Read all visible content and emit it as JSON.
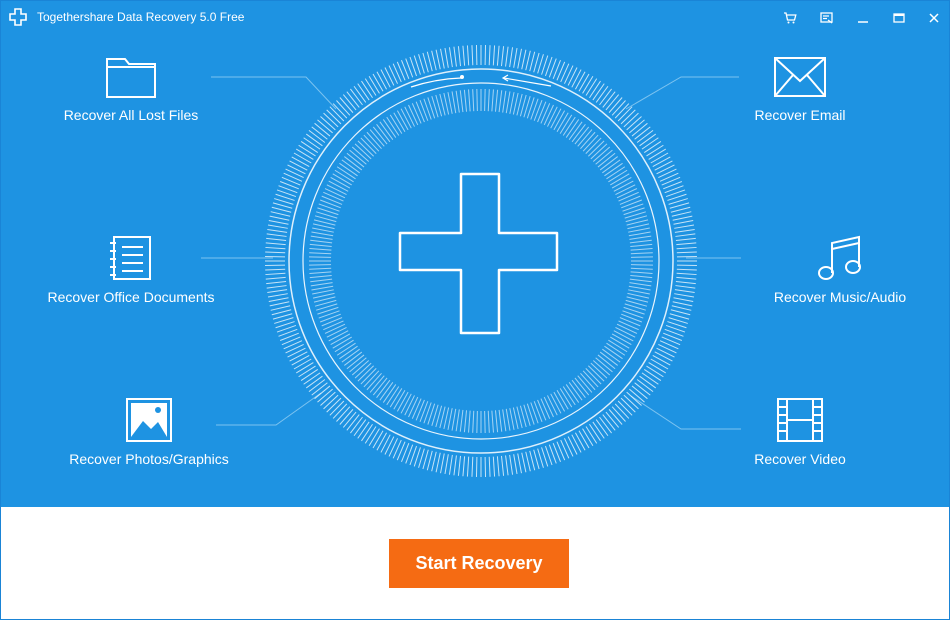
{
  "window": {
    "title": "Togethershare Data Recovery 5.0 Free",
    "controls": [
      "cart-icon",
      "register-icon",
      "minimize-icon",
      "maximize-icon",
      "close-icon"
    ]
  },
  "colors": {
    "main_bg": "#1e93e2",
    "accent": "#f56b13",
    "text": "#ffffff"
  },
  "features": {
    "all_files": {
      "label": "Recover All Lost Files",
      "icon": "folder-icon"
    },
    "office": {
      "label": "Recover Office Documents",
      "icon": "document-icon"
    },
    "photos": {
      "label": "Recover Photos/Graphics",
      "icon": "image-icon"
    },
    "email": {
      "label": "Recover Email",
      "icon": "envelope-icon"
    },
    "music": {
      "label": "Recover Music/Audio",
      "icon": "music-note-icon"
    },
    "video": {
      "label": "Recover Video",
      "icon": "film-icon"
    }
  },
  "actions": {
    "start_label": "Start Recovery"
  }
}
